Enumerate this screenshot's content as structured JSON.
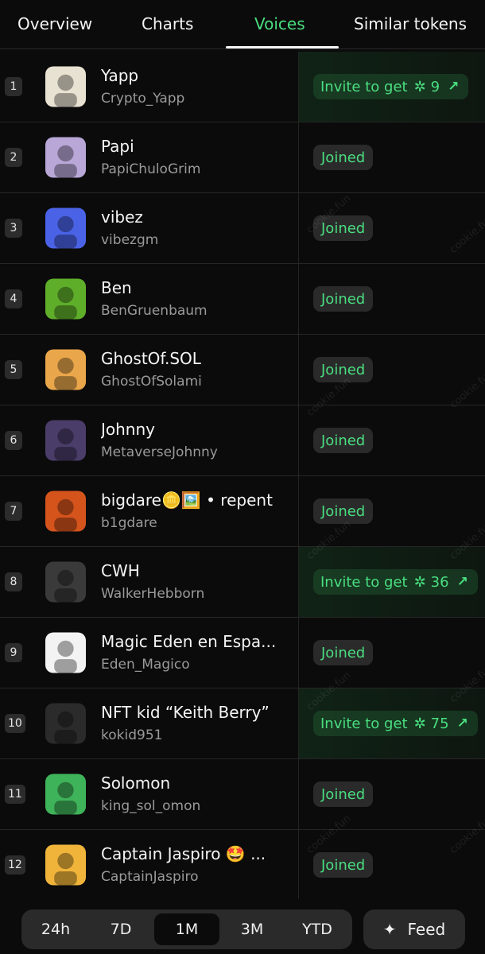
{
  "tabs": [
    {
      "label": "Overview"
    },
    {
      "label": "Charts"
    },
    {
      "label": "Voices",
      "active": true
    },
    {
      "label": "Similar tokens"
    }
  ],
  "watermark_text": "cookie.fun",
  "rows": [
    {
      "rank": "1",
      "name": "Yapp",
      "handle": "Crypto_Yapp",
      "status": "invite",
      "invite_label": "Invite to get",
      "reward": "9"
    },
    {
      "rank": "2",
      "name": "Papi",
      "handle": "PapiChuloGrim",
      "status": "joined",
      "joined_label": "Joined"
    },
    {
      "rank": "3",
      "name": "vibez",
      "handle": "vibezgm",
      "status": "joined",
      "joined_label": "Joined"
    },
    {
      "rank": "4",
      "name": "Ben",
      "handle": "BenGruenbaum",
      "status": "joined",
      "joined_label": "Joined"
    },
    {
      "rank": "5",
      "name": "GhostOf.SOL",
      "handle": "GhostOfSolami",
      "status": "joined",
      "joined_label": "Joined"
    },
    {
      "rank": "6",
      "name": "Johnny",
      "handle": "MetaverseJohnny",
      "status": "joined",
      "joined_label": "Joined"
    },
    {
      "rank": "7",
      "name": "bigdare🪙🖼️ • repent",
      "handle": "b1gdare",
      "status": "joined",
      "joined_label": "Joined"
    },
    {
      "rank": "8",
      "name": "CWH",
      "handle": "WalkerHebborn",
      "status": "invite",
      "invite_label": "Invite to get",
      "reward": "36"
    },
    {
      "rank": "9",
      "name": "Magic Eden en Espa...",
      "handle": "Eden_Magico",
      "status": "joined",
      "joined_label": "Joined"
    },
    {
      "rank": "10",
      "name": "NFT kid “Keith Berry”",
      "handle": "kokid951",
      "status": "invite",
      "invite_label": "Invite to get",
      "reward": "75"
    },
    {
      "rank": "11",
      "name": "Solomon",
      "handle": "king_sol_omon",
      "status": "joined",
      "joined_label": "Joined"
    },
    {
      "rank": "12",
      "name": "Captain Jaspiro 🤩 ...",
      "handle": "CaptainJaspiro",
      "status": "joined",
      "joined_label": "Joined"
    }
  ],
  "avatar_colors": [
    "#e8e2d2",
    "#b9a7d8",
    "#4a63e6",
    "#5fae2a",
    "#e9a64a",
    "#4b3d6a",
    "#d4541c",
    "#3a3a3a",
    "#f3f3f3",
    "#2b2b2b",
    "#3fb35a",
    "#f0b43a"
  ],
  "periods": [
    {
      "label": "24h"
    },
    {
      "label": "7D"
    },
    {
      "label": "1M",
      "active": true
    },
    {
      "label": "3M"
    },
    {
      "label": "YTD"
    }
  ],
  "feed_label": "Feed",
  "icons": {
    "reward": "cookie-icon",
    "invite_arrow": "arrow-up-right-icon",
    "feed": "sparkle-icon"
  },
  "colors": {
    "accent": "#4ade80",
    "background": "#0b0b0b",
    "pill": "#2a2a2a"
  }
}
